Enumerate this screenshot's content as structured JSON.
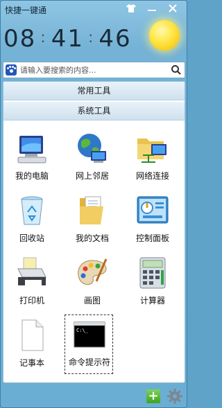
{
  "window": {
    "title": "快捷一键通"
  },
  "clock": {
    "hours": "08",
    "minutes": "41",
    "seconds": "46",
    "separator": ":"
  },
  "weather": {
    "icon": "sun-icon"
  },
  "search": {
    "placeholder": "请输入要搜索的内容..."
  },
  "categories": [
    {
      "label": "常用工具"
    },
    {
      "label": "系统工具"
    }
  ],
  "tools": [
    {
      "label": "我的电脑",
      "icon": "computer-icon"
    },
    {
      "label": "网上邻居",
      "icon": "network-neighborhood-icon"
    },
    {
      "label": "网络连接",
      "icon": "network-connections-icon"
    },
    {
      "label": "回收站",
      "icon": "recycle-bin-icon"
    },
    {
      "label": "我的文档",
      "icon": "documents-folder-icon"
    },
    {
      "label": "控制面板",
      "icon": "control-panel-icon"
    },
    {
      "label": "打印机",
      "icon": "printer-icon"
    },
    {
      "label": "画图",
      "icon": "paint-palette-icon"
    },
    {
      "label": "计算器",
      "icon": "calculator-icon"
    },
    {
      "label": "记事本",
      "icon": "notepad-icon"
    },
    {
      "label": "命令提示符",
      "icon": "command-prompt-icon"
    }
  ],
  "footer": {
    "add_label": "+"
  }
}
